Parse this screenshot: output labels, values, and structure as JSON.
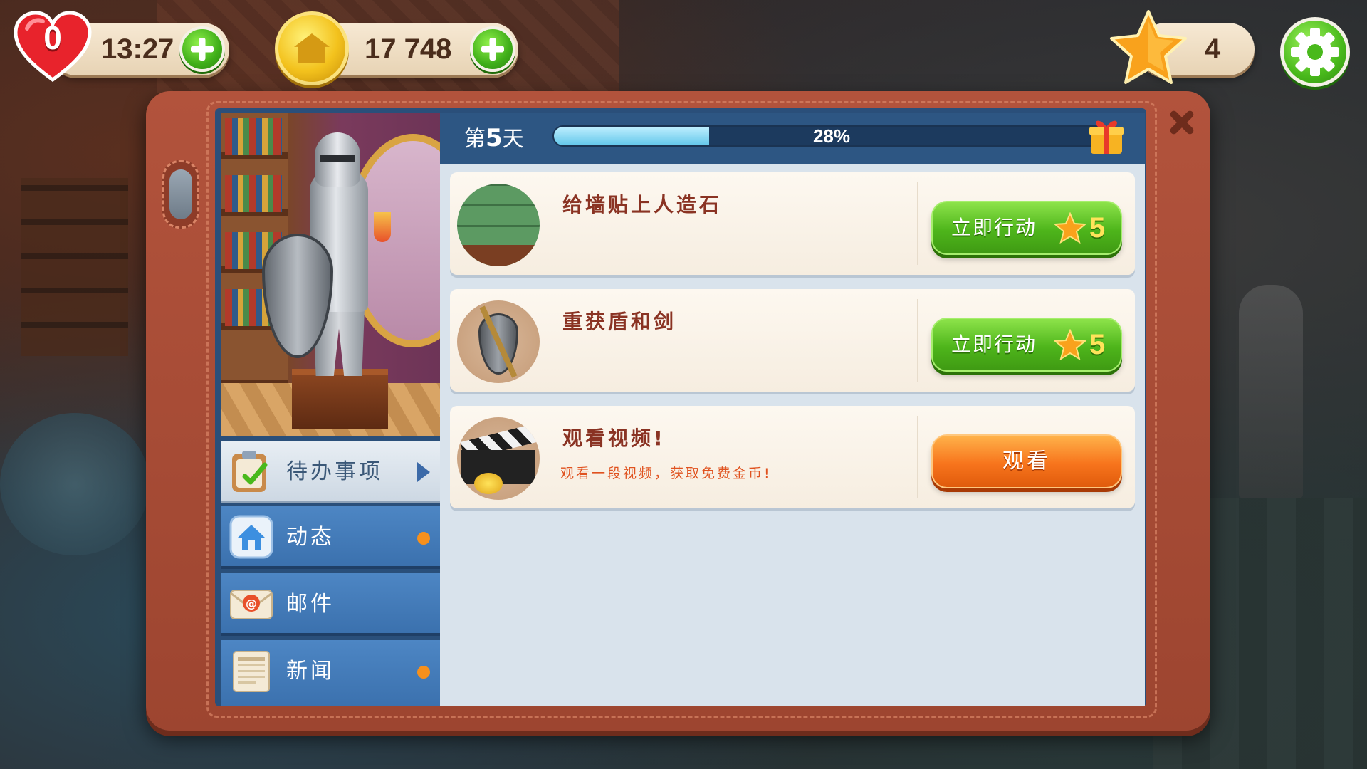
{
  "hud": {
    "lives": "0",
    "timer": "13:27",
    "coins": "17 748",
    "stars": "4"
  },
  "nav": [
    {
      "label": "待办事项"
    },
    {
      "label": "动态"
    },
    {
      "label": "邮件"
    },
    {
      "label": "新闻"
    }
  ],
  "day": {
    "prefix": "第",
    "number": "5",
    "suffix": "天",
    "progress_text": "28%",
    "progress": 0.28
  },
  "tasks": [
    {
      "title": "给墙贴上人造石",
      "button": "立即行动",
      "stars": "5"
    },
    {
      "title": "重获盾和剑",
      "button": "立即行动",
      "stars": "5"
    },
    {
      "title": "观看视频!",
      "subtitle": "观看一段视频，获取免费金币!",
      "button": "观看"
    }
  ],
  "colors": {
    "panel": "#b2533c",
    "accent_green": "#4eb51b",
    "accent_orange": "#f7741c",
    "nav_blue": "#3b71ae",
    "notification_dot": "#f6901c"
  },
  "icons": [
    "heart-icon",
    "plus-icon",
    "coin-icon",
    "star-icon",
    "gear-icon",
    "close-icon",
    "gift-icon",
    "clipboard-icon",
    "house-icon",
    "mail-icon",
    "newspaper-icon"
  ]
}
